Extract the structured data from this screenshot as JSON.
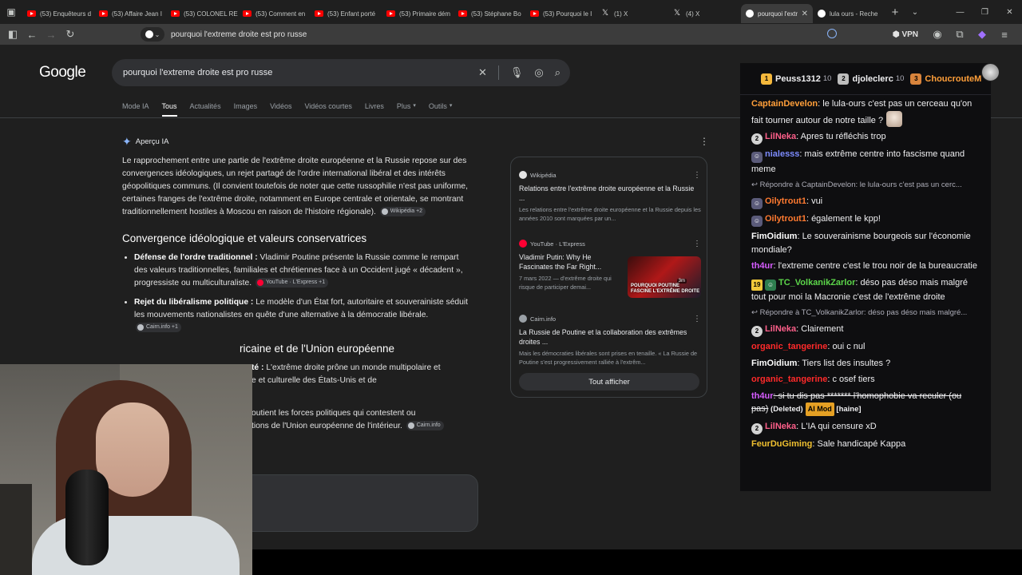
{
  "tabs": [
    {
      "title": "(53) Enquêteurs d",
      "icon": "youtube-icon",
      "active": false
    },
    {
      "title": "(53) Affaire Jean I",
      "icon": "youtube-icon",
      "active": false
    },
    {
      "title": "(53) COLONEL RE",
      "icon": "youtube-icon",
      "active": false
    },
    {
      "title": "(53) Comment en",
      "icon": "youtube-icon",
      "active": false
    },
    {
      "title": "(53) Enfant porté",
      "icon": "youtube-icon",
      "active": false
    },
    {
      "title": "(53) Primaire dém",
      "icon": "youtube-icon",
      "active": false
    },
    {
      "title": "(53) Stéphane Bo",
      "icon": "youtube-icon",
      "active": false
    },
    {
      "title": "(53) Pourquoi le I",
      "icon": "youtube-icon",
      "active": false
    },
    {
      "title": "(1) X",
      "icon": "x-icon",
      "active": false
    },
    {
      "title": "(4) X",
      "icon": "x-icon",
      "active": false
    },
    {
      "title": "pourquoi l'extr",
      "icon": "google-icon",
      "active": true
    },
    {
      "title": "lula ours - Reche",
      "icon": "google-icon",
      "active": false
    }
  ],
  "toolbar": {
    "url": "pourquoi l'extreme droite est pro russe",
    "vpn_label": "VPN"
  },
  "google": {
    "logo": "Google",
    "query": "pourquoi l'extreme droite est pro russe",
    "nav": [
      "Mode IA",
      "Tous",
      "Actualités",
      "Images",
      "Vidéos",
      "Vidéos courtes",
      "Livres",
      "Plus",
      "Outils"
    ],
    "active_nav": "Tous",
    "aio": {
      "label": "Aperçu IA",
      "intro": "Le rapprochement entre une partie de l'extrême droite européenne et la Russie repose sur des convergences idéologiques, un rejet partagé de l'ordre international libéral et des intérêts géopolitiques communs. (Il convient toutefois de noter que cette russophilie n'est pas uniforme, certaines franges de l'extrême droite, notamment en Europe centrale et orientale, se montrant traditionnellement hostiles à Moscou en raison de l'histoire régionale).",
      "intro_chip": "Wikipédia +2",
      "h1": "Convergence idéologique et valeurs conservatrices",
      "b1_title": "Défense de l'ordre traditionnel :",
      "b1_text": " Vladimir Poutine présente la Russie comme le rempart des valeurs traditionnelles, familiales et chrétiennes face à un Occident jugé « décadent », progressiste ou multiculturaliste.",
      "b1_chip": "YouTube · L'Express +1",
      "b2_title": "Rejet du libéralisme politique :",
      "b2_text": " Le modèle d'un État fort, autoritaire et souverainiste séduit les mouvements nationalistes en quête d'une alternative à la démocratie libérale.",
      "b2_chip": "Cairn.info +1",
      "h2_partial": "ricaine et de l'Union européenne",
      "b3_partial_title": "té :",
      "b3_partial_text": " L'extrême droite prône un monde multipolaire et",
      "b3_partial_text2": "e et culturelle des États-Unis et de",
      "b4_partial_text": "outient les forces politiques qui contestent ou",
      "b4_partial_text2": "tions de l'Union européenne de l'intérieur.",
      "b4_chip": "Cairn.info"
    },
    "sources": [
      {
        "site": "Wikipédia",
        "title": "Relations entre l'extrême droite européenne et la Russie ...",
        "desc": "Les relations entre l'extrême droite européenne et la Russie depuis les années 2010 sont marquées par un..."
      },
      {
        "site": "YouTube",
        "site2": "L'Express",
        "title": "Vladimir Putin: Why He Fascinates the Far Right...",
        "desc": "7 mars 2022 — d'extrême droite qui risque de participer demai...",
        "thumb_text": "POURQUOI POUTINE FASCINE L'EXTRÊME DROITE",
        "duration": "3m"
      },
      {
        "site": "Cairn.info",
        "title": "La Russie de Poutine et la collaboration des extrêmes droites ...",
        "desc": "Mais les démocraties libérales sont prises en tenaille. « La Russie de Poutine s'est progressivement ralliée à l'extrêm..."
      }
    ],
    "show_all": "Tout afficher"
  },
  "chat": {
    "leaders": [
      {
        "rank": "1",
        "name": "Peuss1312",
        "count": "10"
      },
      {
        "rank": "2",
        "name": "djoleclerc",
        "count": "10"
      },
      {
        "rank": "3",
        "name": "ChoucrouteM",
        "count": ""
      }
    ],
    "messages": [
      {
        "user": "CaptainDevelon",
        "color": "#ff9f3a",
        "text": ": le lula-ours c'est pas un cerceau qu'on fait tourner autour de notre taille ?",
        "badge": "",
        "emote": true
      },
      {
        "user": "LilNeka",
        "color": "#ff5f8a",
        "text": ": Apres tu réfléchis trop",
        "badge": "2"
      },
      {
        "user": "nialesss",
        "color": "#7d8cff",
        "text": ": mais extrême centre into fascisme quand meme",
        "badge": "bot"
      },
      {
        "reply": "Répondre à CaptainDevelon: le lula-ours c'est pas un cerc..."
      },
      {
        "user": "Oilytrout1",
        "color": "#ff7a30",
        "text": ": vui",
        "badge": "bot"
      },
      {
        "user": "Oilytrout1",
        "color": "#ff7a30",
        "text": ": également le kpp!",
        "badge": "bot"
      },
      {
        "user": "FimOidium",
        "color": "#ffffff",
        "text": ": Le souverainisme bourgeois sur l'économie mondiale?",
        "badge": ""
      },
      {
        "user": "th4ur",
        "color": "#d65cff",
        "text": ": l'extreme centre c'est le trou noir de la bureaucratie",
        "badge": ""
      },
      {
        "user": "TC_VolkanikZarlor",
        "color": "#5cd64a",
        "text": ": déso pas déso mais malgré tout pour moi la Macronie c'est de l'extrême droite",
        "badge": "19"
      },
      {
        "reply": "Répondre à TC_VolkanikZarlor: déso pas déso mais malgré..."
      },
      {
        "user": "LilNeka",
        "color": "#ff5f8a",
        "text": ": Clairement",
        "badge": "2"
      },
      {
        "user": "organic_tangerine",
        "color": "#ff2a2a",
        "text": ": oui c nul",
        "badge": ""
      },
      {
        "user": "FimOidium",
        "color": "#ffffff",
        "text": ": Tiers list des insultes ?",
        "badge": ""
      },
      {
        "user": "organic_tangerine",
        "color": "#ff2a2a",
        "text": ": c osef tiers",
        "badge": ""
      },
      {
        "user": "th4ur",
        "color": "#d65cff",
        "text": ": si tu dis pas ******* l'homophobie va reculer (ou pas)",
        "strike": true,
        "deleted": " (Deleted)",
        "tag": "AI Mod",
        "tag2": " [haine]",
        "badge": ""
      },
      {
        "user": "LilNeka",
        "color": "#ff5f8a",
        "text": ": L'IA qui censure xD",
        "badge": "2"
      },
      {
        "user": "FeurDuGiming",
        "color": "#f0c030",
        "text": ": Sale handicapé Kappa",
        "badge": ""
      }
    ]
  }
}
